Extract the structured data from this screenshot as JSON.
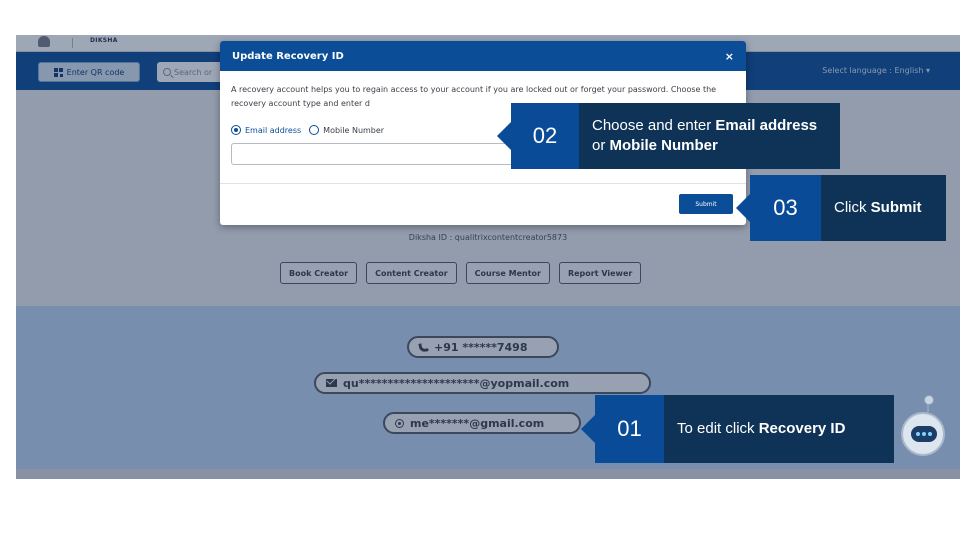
{
  "app": {
    "brand": "DIKSHA",
    "navbar": {
      "qr_label": "Enter QR code",
      "search_placeholder": "Search or",
      "language_label": "Select language : English ▾"
    },
    "profile": {
      "diksha_id": "Diksha ID : qualitrixcontentcreator5873",
      "roles": [
        "Book Creator",
        "Content Creator",
        "Course Mentor",
        "Report Viewer"
      ]
    },
    "contacts": {
      "phone": "+91 ******7498",
      "email": "qu*********************@yopmail.com",
      "recovery": "me*******@gmail.com"
    }
  },
  "modal": {
    "title": "Update Recovery ID",
    "close": "×",
    "description": "A recovery account helps you to regain access to your account if you are locked out or forget your password. Choose the recovery account type and enter d",
    "options": [
      "Email address",
      "Mobile Number"
    ],
    "selected_option": "Email address",
    "input_value": "",
    "submit_label": "Submit"
  },
  "callouts": {
    "step1": {
      "number": "01",
      "text_prefix": "To edit click ",
      "text_bold": "Recovery ID"
    },
    "step2": {
      "number": "02",
      "text_prefix": "Choose and enter ",
      "text_bold_1": "Email address",
      "text_mid": " or ",
      "text_bold_2": "Mobile Number"
    },
    "step3": {
      "number": "03",
      "text_prefix": "Click ",
      "text_bold": "Submit"
    }
  },
  "colors": {
    "navbar": "#0b4d96",
    "callout_number_bg": "#0a4b98",
    "callout_text_bg": "#0e3357",
    "contact_panel": "#bcd4f2"
  }
}
